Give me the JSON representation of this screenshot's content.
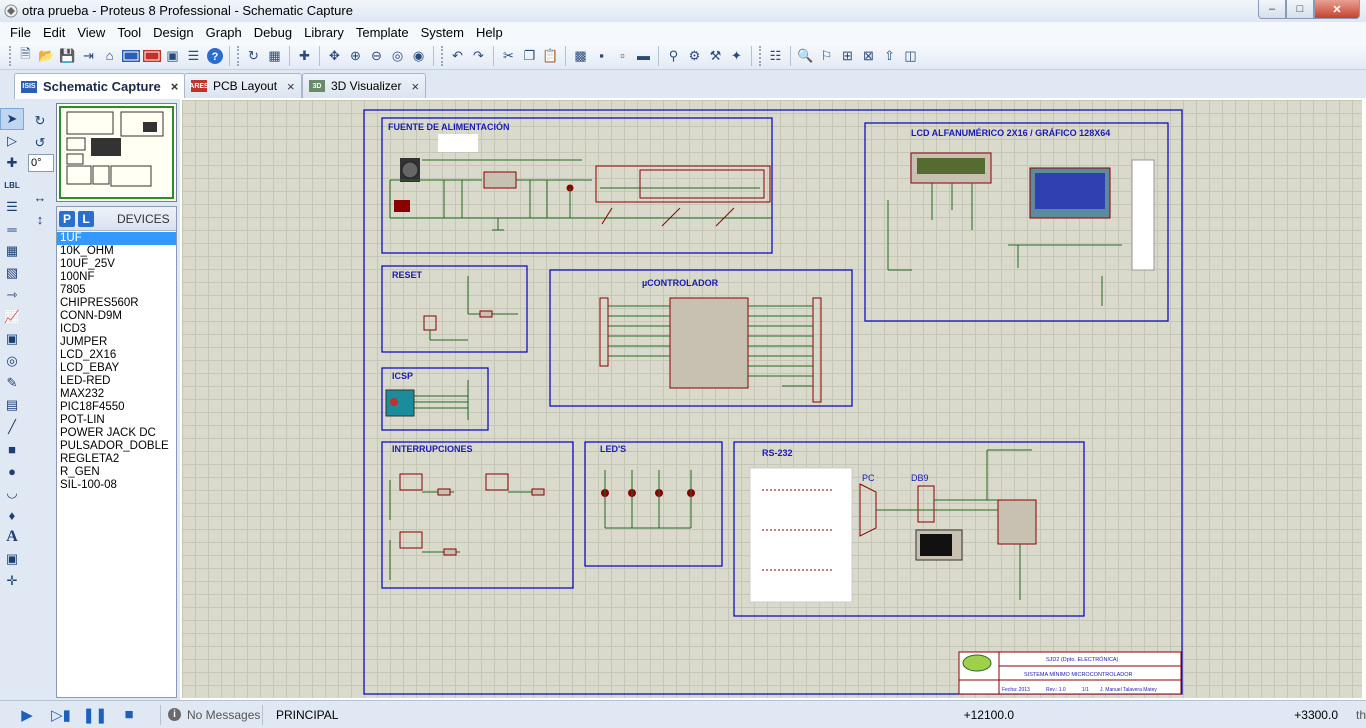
{
  "window": {
    "title": "otra prueba - Proteus 8 Professional - Schematic Capture",
    "min_glyph": "–",
    "max_glyph": "□",
    "close_glyph": "✕"
  },
  "menu": [
    "File",
    "Edit",
    "View",
    "Tool",
    "Design",
    "Graph",
    "Debug",
    "Library",
    "Template",
    "System",
    "Help"
  ],
  "tabs": [
    {
      "label": "Schematic Capture",
      "icon": "ISIS",
      "close": "×"
    },
    {
      "label": "PCB Layout",
      "icon": "ARES",
      "close": "×"
    },
    {
      "label": "3D Visualizer",
      "icon": "3D",
      "close": "×"
    }
  ],
  "sidebar": {
    "rotation": "0°",
    "devices_title": "DEVICES",
    "pick_btn": "P",
    "lib_btn": "L",
    "devices": [
      "1UF",
      "10K_OHM",
      "10UF_25V",
      "100NF",
      "7805",
      "CHIPRES560R",
      "CONN-D9M",
      "ICD3",
      "JUMPER",
      "LCD_2X16",
      "LCD_EBAY",
      "LED-RED",
      "MAX232",
      "PIC18F4550",
      "POT-LIN",
      "POWER JACK DC",
      "PULSADOR_DOBLE",
      "REGLETA2",
      "R_GEN",
      "SIL-100-08"
    ],
    "selected_device": "1UF"
  },
  "schematic": {
    "blocks": {
      "fuente": "FUENTE DE ALIMENTACIÓN",
      "lcd": "LCD ALFANUMÉRICO 2X16 / GRÁFICO 128X64",
      "reset": "RESET",
      "micro": "µCONTROLADOR",
      "icsp": "ICSP",
      "interrupciones": "INTERRUPCIONES",
      "leds": "LED'S",
      "rs232": "RS-232",
      "pc_label": "PC",
      "db9_label": "DB9"
    },
    "title_block": {
      "org": "SJD2 (Dpto. ELECTRÓNICA)",
      "project": "SISTEMA MÍNIMO MICROCONTROLADOR",
      "fecha": "Fecha: 2013",
      "rev": "Rev.: 1.0",
      "sheet": "1/1",
      "author": "J. Manuel Talavera Matey"
    }
  },
  "status": {
    "messages": "No Messages",
    "sheet": "PRINCIPAL",
    "x": "+12100.0",
    "y": "+3300.0",
    "units": "th"
  },
  "colors": {
    "wire": "#1f6b1f",
    "part": "#8b0000",
    "block_border": "#0000c0",
    "block_text": "#1a1ab4",
    "sheet_bg": "#d9d9cc",
    "selection": "#3399ff"
  }
}
